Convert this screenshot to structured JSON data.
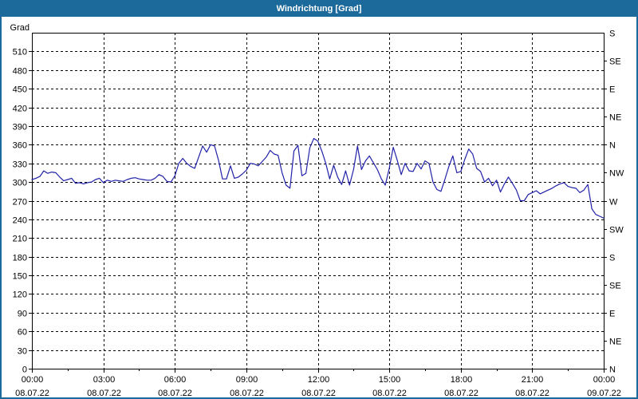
{
  "window": {
    "title": "Windrichtung [Grad]"
  },
  "colors": {
    "titlebar_bg": "#1c699b",
    "frame_border": "#1c699b",
    "title_text": "#ffffff",
    "plot_bg": "#ffffff",
    "axis": "#000000",
    "grid": "#000000",
    "line": "#2121a8"
  },
  "chart_data": {
    "type": "line",
    "title": "Windrichtung [Grad]",
    "legend_position": "none",
    "grid": {
      "style": "dashed",
      "color": "#000000"
    },
    "y_axis_left": {
      "label": "Grad",
      "min": 0,
      "max": 540,
      "tick_step": 30,
      "tick_labels": [
        "0",
        "30",
        "60",
        "90",
        "120",
        "150",
        "180",
        "210",
        "240",
        "270",
        "300",
        "330",
        "360",
        "390",
        "420",
        "450",
        "480",
        "510"
      ]
    },
    "y_axis_right": {
      "ticks": [
        {
          "value": 540,
          "label": "S"
        },
        {
          "value": 495,
          "label": "SE"
        },
        {
          "value": 450,
          "label": "E"
        },
        {
          "value": 405,
          "label": "NE"
        },
        {
          "value": 360,
          "label": "N"
        },
        {
          "value": 315,
          "label": "NW"
        },
        {
          "value": 270,
          "label": "W"
        },
        {
          "value": 225,
          "label": "SW"
        },
        {
          "value": 180,
          "label": "S"
        },
        {
          "value": 135,
          "label": "SE"
        },
        {
          "value": 90,
          "label": "E"
        },
        {
          "value": 45,
          "label": "NE"
        },
        {
          "value": 0,
          "label": "N"
        }
      ]
    },
    "x_axis": {
      "range_hours": [
        0,
        24
      ],
      "major_tick_step_hours": 3,
      "minor_tick_step_hours": 1.5,
      "ticks": [
        {
          "hour": 0,
          "time": "00:00",
          "date": "08.07.22"
        },
        {
          "hour": 3,
          "time": "03:00",
          "date": "08.07.22"
        },
        {
          "hour": 6,
          "time": "06:00",
          "date": "08.07.22"
        },
        {
          "hour": 9,
          "time": "09:00",
          "date": "08.07.22"
        },
        {
          "hour": 12,
          "time": "12:00",
          "date": "08.07.22"
        },
        {
          "hour": 15,
          "time": "15:00",
          "date": "08.07.22"
        },
        {
          "hour": 18,
          "time": "18:00",
          "date": "08.07.22"
        },
        {
          "hour": 21,
          "time": "21:00",
          "date": "08.07.22"
        },
        {
          "hour": 24,
          "time": "00:00",
          "date": "09.07.22"
        }
      ]
    },
    "series": [
      {
        "name": "Windrichtung",
        "color": "#2121a8",
        "start_hour": 0,
        "interval_minutes": 10,
        "values": [
          304,
          306,
          309,
          318,
          314,
          316,
          315,
          308,
          302,
          304,
          306,
          298,
          299,
          297,
          299,
          300,
          304,
          306,
          299,
          303,
          301,
          303,
          302,
          301,
          304,
          306,
          307,
          305,
          304,
          303,
          303,
          306,
          312,
          309,
          301,
          300,
          310,
          330,
          338,
          330,
          325,
          322,
          340,
          358,
          348,
          360,
          358,
          335,
          305,
          305,
          326,
          306,
          308,
          313,
          319,
          330,
          329,
          326,
          333,
          340,
          351,
          345,
          343,
          315,
          295,
          290,
          350,
          359,
          310,
          314,
          355,
          370,
          366,
          350,
          330,
          305,
          327,
          308,
          296,
          318,
          295,
          320,
          358,
          320,
          334,
          342,
          331,
          320,
          305,
          295,
          322,
          356,
          335,
          312,
          330,
          318,
          317,
          330,
          321,
          334,
          330,
          300,
          288,
          285,
          304,
          325,
          342,
          315,
          317,
          336,
          353,
          345,
          322,
          317,
          300,
          306,
          294,
          303,
          284,
          297,
          308,
          298,
          287,
          270,
          270,
          280,
          283,
          286,
          281,
          284,
          287,
          290,
          294,
          297,
          299,
          293,
          291,
          290,
          283,
          287,
          296,
          257,
          248,
          245,
          242
        ]
      }
    ]
  }
}
